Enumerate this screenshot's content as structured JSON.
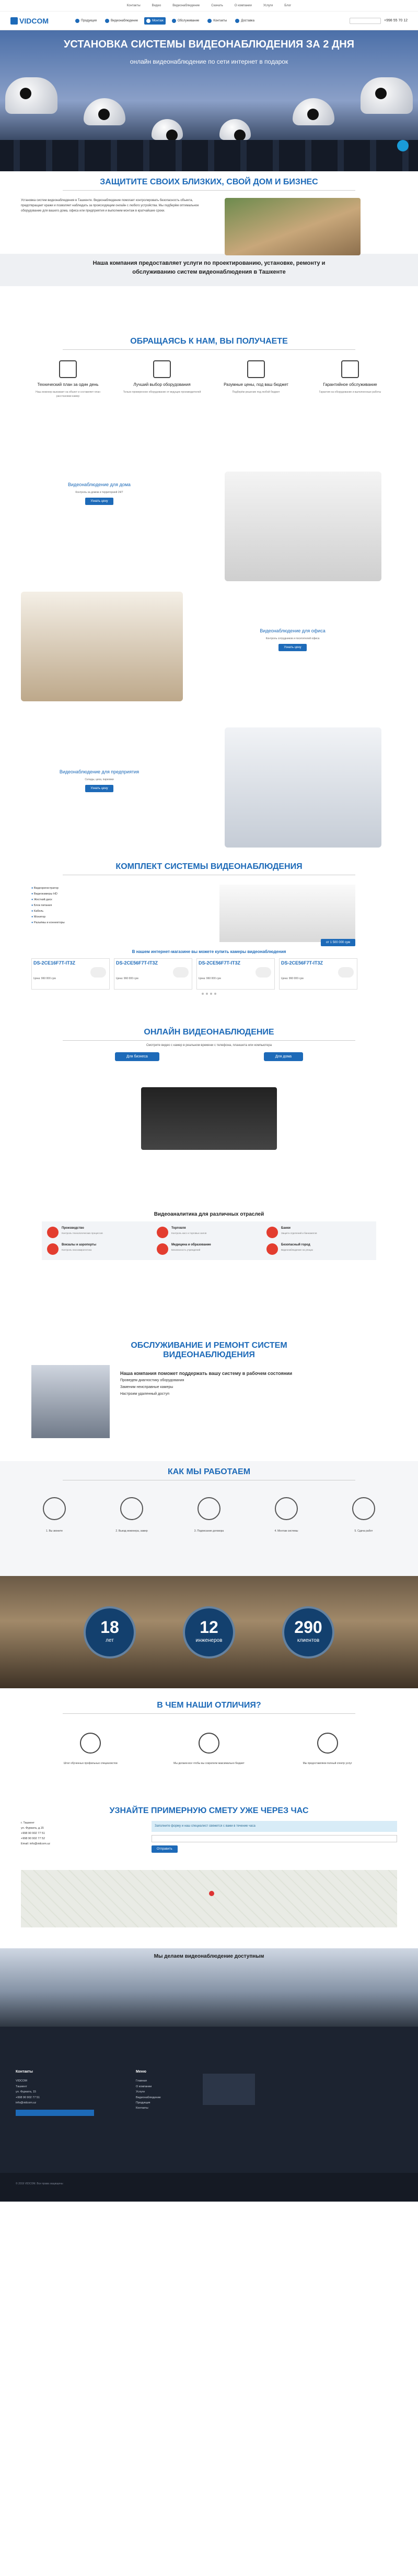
{
  "topbar": {
    "links": [
      "Контакты",
      "Видео",
      "Видеонаблюдение",
      "Скачать",
      "О компании",
      "Услуги",
      "Блог"
    ]
  },
  "header": {
    "logo": "VIDCOM",
    "nav": [
      "Продукция",
      "Видеонаблюдение",
      "Монтаж",
      "Обслуживание",
      "Контакты",
      "Доставка"
    ],
    "phone": "+998 55 70 12"
  },
  "hero": {
    "title": "УСТАНОВКА СИСТЕМЫ ВИДЕОНАБЛЮДЕНИЯ ЗА 2 ДНЯ",
    "subtitle": "онлайн видеонаблюдение по сети интернет в подарок"
  },
  "protect": {
    "title": "ЗАЩИТИТЕ СВОИХ БЛИЗКИХ, СВОЙ ДОМ И БИЗНЕС",
    "text": "Установка систем видеонаблюдения в Ташкенте. Видеонаблюдение помогает контролировать безопасность объекта, предотвращает кражи и позволяет наблюдать за происходящим онлайн с любого устройства. Мы подберём оптимальное оборудование для вашего дома, офиса или предприятия и выполним монтаж в кратчайшие сроки."
  },
  "banner": {
    "text": "Наша компания предоставляет услуги по проектированию, установке, ремонту и обслуживанию систем видеонаблюдения в Ташкенте"
  },
  "offer": {
    "title": "ОБРАЩАЯСЬ К НАМ, ВЫ ПОЛУЧАЕТЕ",
    "items": [
      {
        "t": "Технический план за один день",
        "d": "Наш инженер выезжает на объект и составляет план расстановки камер"
      },
      {
        "t": "Лучший выбор оборудования",
        "d": "Только проверенное оборудование от ведущих производителей"
      },
      {
        "t": "Разумные цены, под ваш бюджет",
        "d": "Подберём решение под любой бюджет"
      },
      {
        "t": "Гарантийное обслуживание",
        "d": "Гарантия на оборудование и выполненные работы"
      }
    ]
  },
  "scenes": [
    {
      "title": "Видеонаблюдение для дома",
      "text": "Контроль за домом и территорией 24/7",
      "btn": "Узнать цену"
    },
    {
      "title": "Видеонаблюдение для офиса",
      "text": "Контроль сотрудников и посетителей офиса",
      "btn": "Узнать цену"
    },
    {
      "title": "Видеонаблюдение для предприятия",
      "text": "Склады, цеха, парковки",
      "btn": "Узнать цену"
    }
  ],
  "kit": {
    "title": "КОМПЛЕКТ СИСТЕМЫ ВИДЕОНАБЛЮДЕНИЯ",
    "items": [
      "Видеорегистратор",
      "Видеокамеры HD",
      "Жесткий диск",
      "Блок питания",
      "Кабель",
      "Монитор",
      "Разъёмы и коннекторы"
    ],
    "price": "от 1 500 000 сум",
    "note": "В нашем интернет-магазине вы можете купить камеры видеонаблюдения"
  },
  "products": [
    {
      "name": "DS-2CE16F7T-IT3Z",
      "price": "Цена: 960 000 сум"
    },
    {
      "name": "DS-2CE56F7T-IT3Z",
      "price": "Цена: 960 000 сум"
    },
    {
      "name": "DS-2CE56F7T-IT3Z",
      "price": "Цена: 960 000 сум"
    },
    {
      "name": "DS-2CE56F7T-IT3Z",
      "price": "Цена: 960 000 сум"
    }
  ],
  "online": {
    "title": "ОНЛАЙН ВИДЕОНАБЛЮДЕНИЕ",
    "text": "Смотрите видео с камер в реальном времени с телефона, планшета или компьютера",
    "btn1": "Для бизнеса",
    "btn2": "Для дома"
  },
  "analytics": {
    "title": "Видеоаналитика для различных отраслей",
    "items": [
      {
        "t": "Производство",
        "d": "Контроль технологических процессов"
      },
      {
        "t": "Торговля",
        "d": "Контроль касс и торговых залов"
      },
      {
        "t": "Банки",
        "d": "Защита отделений и банкоматов"
      },
      {
        "t": "Вокзалы и аэропорты",
        "d": "Контроль пассажиропотока"
      },
      {
        "t": "Медицина и образование",
        "d": "Безопасность учреждений"
      },
      {
        "t": "Безопасный город",
        "d": "Видеонаблюдение на улицах"
      }
    ]
  },
  "repair": {
    "title": "ОБСЛУЖИВАНИЕ И РЕМОНТ СИСТЕМ ВИДЕОНАБЛЮДЕНИЯ",
    "lead": "Наша компания поможет поддержать вашу систему в рабочем состоянии",
    "lines": [
      "Проведем диагностику оборудования",
      "Заменим неисправные камеры",
      "Настроим удаленный доступ"
    ]
  },
  "how": {
    "title": "КАК МЫ РАБОТАЕМ",
    "steps": [
      "1. Вы звоните",
      "2. Выезд инженера, замер",
      "3. Подписание договора",
      "4. Монтаж системы",
      "5. Сдача работ"
    ]
  },
  "stats": [
    {
      "n": "18",
      "l": "лет"
    },
    {
      "n": "12",
      "l": "инженеров"
    },
    {
      "n": "290",
      "l": "клиентов"
    }
  ],
  "diff": {
    "title": "В ЧЕМ НАШИ ОТЛИЧИЯ?",
    "items": [
      "Штат обученных профильных специалистов",
      "Мы делаем все чтобы вы сократили максимально бюджет",
      "Мы предоставляем полный спектр услуг"
    ]
  },
  "estimate": {
    "title": "УЗНАЙТЕ ПРИМЕРНУЮ СМЕТУ УЖЕ ЧЕРЕЗ ЧАС",
    "contact": [
      "г. Ташкент",
      "ул. Фурката, д.15",
      "+998 90 902 77 51",
      "+998 90 902 77 52",
      "Email: info@vidcom.uz"
    ],
    "note": "Заполните форму и наш специалист свяжется с вами в течение часа",
    "btn": "Отправить"
  },
  "pitch": {
    "title": "Мы делаем видеонаблюдение доступным"
  },
  "footer": {
    "col1": "Контакты",
    "col1_lines": [
      "VIDCOM",
      "Ташкент",
      "ул. Фурката, 15",
      "+998 90 902 77 51",
      "info@vidcom.uz"
    ],
    "col2": "Меню",
    "col2_lines": [
      "Главная",
      "О компании",
      "Услуги",
      "Видеонаблюдение",
      "Продукция",
      "Контакты"
    ],
    "copy": "© 2019 VIDCOM. Все права защищены"
  }
}
